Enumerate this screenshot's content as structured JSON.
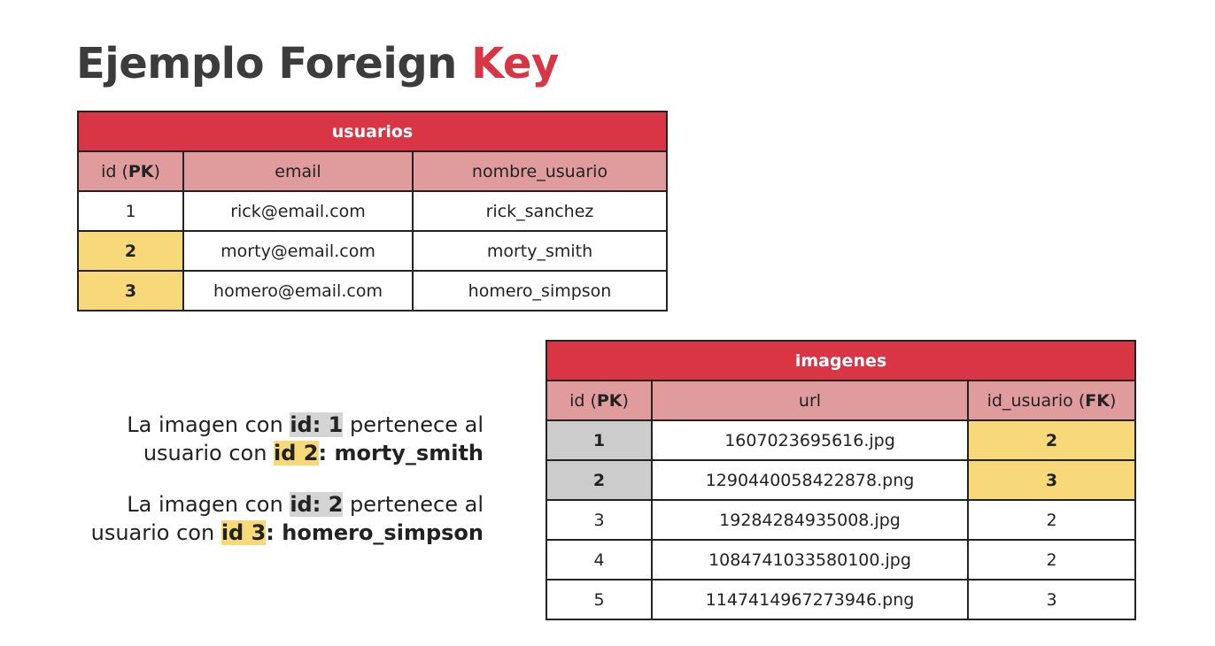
{
  "title": {
    "main": "Ejemplo Foreign",
    "accent": "Key"
  },
  "colors": {
    "accent": "#d93645",
    "header_pink": "#e09b9c",
    "highlight_yellow": "#f8d97a",
    "highlight_grey": "#cccccc"
  },
  "usuarios": {
    "caption": "usuarios",
    "headers": {
      "id_text": "id (",
      "id_key": "PK",
      "id_close": ")",
      "email": "email",
      "nombre": "nombre_usuario"
    },
    "rows": [
      {
        "id": "1",
        "email": "rick@email.com",
        "nombre": "rick_sanchez"
      },
      {
        "id": "2",
        "email": "morty@email.com",
        "nombre": "morty_smith"
      },
      {
        "id": "3",
        "email": "homero@email.com",
        "nombre": "homero_simpson"
      }
    ]
  },
  "imagenes": {
    "caption": "imagenes",
    "headers": {
      "id_text": "id (",
      "id_key": "PK",
      "id_close": ")",
      "url": "url",
      "fk_text": "id_usuario (",
      "fk_key": "FK",
      "fk_close": ")"
    },
    "rows": [
      {
        "id": "1",
        "url": "1607023695616.jpg",
        "id_usuario": "2"
      },
      {
        "id": "2",
        "url": "1290440058422878.png",
        "id_usuario": "3"
      },
      {
        "id": "3",
        "url": "19284284935008.jpg",
        "id_usuario": "2"
      },
      {
        "id": "4",
        "url": "1084741033580100.jpg",
        "id_usuario": "2"
      },
      {
        "id": "5",
        "url": "1147414967273946.png",
        "id_usuario": "3"
      }
    ]
  },
  "notes": [
    {
      "pre": "La imagen con ",
      "img_id": "id: 1",
      "mid": " pertenece al",
      "line2": "usuario con ",
      "user_id": "id 2",
      "user_name": ": morty_smith"
    },
    {
      "pre": "La imagen con ",
      "img_id": "id: 2",
      "mid": " pertenece al",
      "line2": "usuario con ",
      "user_id": "id 3",
      "user_name": ": homero_simpson"
    }
  ]
}
